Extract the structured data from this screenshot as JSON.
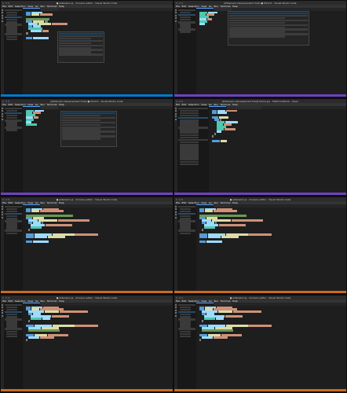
{
  "cells": [
    {
      "title": "● extension.js - monaco-editor - Visual Studio Code",
      "status": "blue"
    },
    {
      "title": "[Extension Development Host] ● Pivot.tl - Visual Studio Code",
      "status": "purple"
    },
    {
      "title": "[Extension Development Host] ● Pivot.tl - Visual Studio Code",
      "status": "purple"
    },
    {
      "title": "[Extension Development Host] Home.jsx - FileFormsPivot - Visua",
      "status": "purple"
    },
    {
      "title": "● extension.js - monaco-editor - Visual Studio Code",
      "status": "orange"
    },
    {
      "title": "● extension.js - monaco-editor - Visual Studio Code",
      "status": "orange"
    },
    {
      "title": "● extension.js - monaco-editor - Visual Studio Code",
      "status": "orange"
    },
    {
      "title": "● extension.js - monaco-editor - Visual Studio Code",
      "status": "orange"
    }
  ],
  "menu": [
    "File",
    "Edit",
    "Selection",
    "View",
    "Go",
    "Run",
    "Terminal",
    "Help"
  ]
}
